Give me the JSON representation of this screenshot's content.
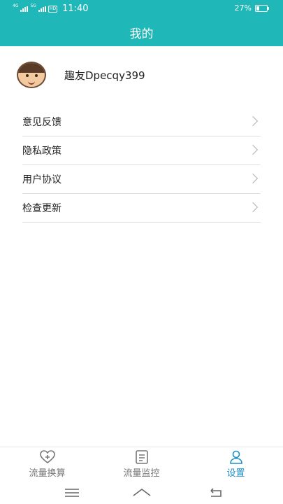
{
  "status_bar": {
    "signal_1": "4G",
    "signal_2": "5G",
    "hd": "HD",
    "time": "11:40",
    "battery": "27%"
  },
  "header": {
    "title": "我的"
  },
  "profile": {
    "username": "趣友Dpecqy399",
    "avatar_icon": "avatar-icon"
  },
  "menu": [
    {
      "label": "意见反馈"
    },
    {
      "label": "隐私政策"
    },
    {
      "label": "用户协议"
    },
    {
      "label": "检查更新"
    }
  ],
  "tabs": [
    {
      "label": "流量换算",
      "icon": "heart-plus-icon",
      "active": false
    },
    {
      "label": "流量监控",
      "icon": "document-icon",
      "active": false
    },
    {
      "label": "设置",
      "icon": "user-icon",
      "active": true
    }
  ],
  "colors": {
    "primary": "#1fb7b7",
    "active_tab": "#1a8fc9"
  }
}
